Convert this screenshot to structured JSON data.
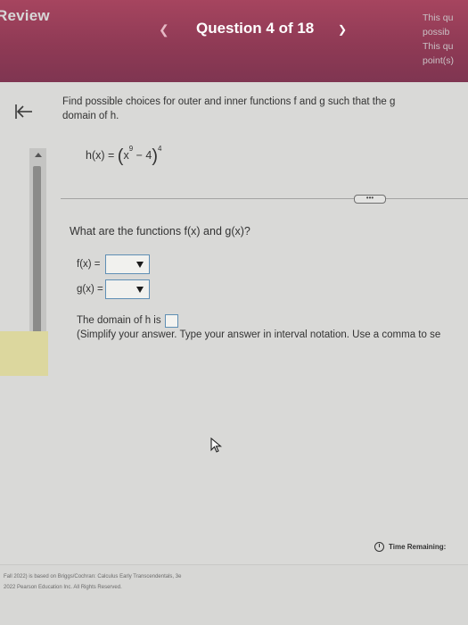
{
  "header": {
    "review_label": "Review",
    "question_title": "Question 4 of 18",
    "points_lines": [
      "This qu",
      "possib",
      "This qu",
      "point(s)"
    ]
  },
  "prompt": {
    "line1": "Find possible choices for outer and inner functions f and g such that the g",
    "line2": "domain of h."
  },
  "formula": {
    "lhs": "h(x) = ",
    "base": "x",
    "inner_exp": "9",
    "minus_const": " − 4",
    "outer_exp": "4"
  },
  "question": "What are the functions f(x) and g(x)?",
  "fields": {
    "f_label": "f(x) =",
    "g_label": "g(x) ="
  },
  "domain": {
    "text": "The domain of h is",
    "hint": "(Simplify your answer. Type your answer in interval notation. Use a comma to se"
  },
  "time_label": "Time Remaining:",
  "footer": {
    "line1": "Fall 2022) is based on Briggs/Cochran: Calculus Early Transcendentals, 3e",
    "line2": "2022 Pearson Education Inc. All Rights Reserved."
  },
  "colors": {
    "header_bg": "#8f3a55",
    "input_border": "#5f8fb4",
    "yellow_bar": "#dcd79e"
  },
  "icons": {
    "back": "collapse-left-arrow-icon",
    "prev": "chevron-left-icon",
    "next": "chevron-right-icon",
    "time": "clock-icon",
    "cursor": "mouse-pointer-icon"
  }
}
